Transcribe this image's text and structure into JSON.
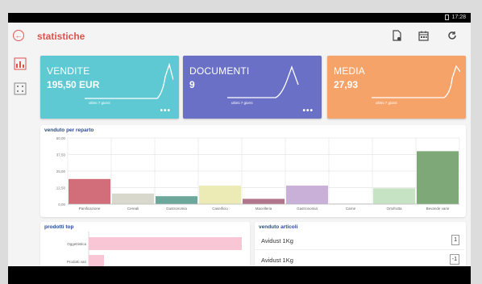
{
  "status": {
    "time": "17:28"
  },
  "app": {
    "title": "statistiche"
  },
  "cards": [
    {
      "label": "VENDITE",
      "value": "195,50 EUR",
      "sub": "ultimi 7 giorni",
      "color": "#5ec9d3"
    },
    {
      "label": "DOCUMENTI",
      "value": "9",
      "sub": "ultimi 7 giorni",
      "color": "#6a70c6"
    },
    {
      "label": "MEDIA",
      "value": "27,93",
      "sub": "ultimi 7 giorni",
      "color": "#f6a36a"
    }
  ],
  "bar_panel": {
    "title": "venduto per reparto"
  },
  "chart_data": {
    "type": "bar",
    "title": "venduto per reparto",
    "categories": [
      "Panificazione",
      "Cereali",
      "Gastronomia",
      "Caseificio",
      "Macelleria",
      "Gastronomia",
      "Carne",
      "Ortofrutta",
      "Bevande varie"
    ],
    "values": [
      19,
      8,
      6,
      14,
      4,
      14,
      0.3,
      12,
      40
    ],
    "colors": [
      "#d16e7a",
      "#d9d8cc",
      "#6ba89b",
      "#ecebb5",
      "#b2768c",
      "#c8b0d8",
      "#7e9a8a",
      "#c6e3c4",
      "#7fa878"
    ],
    "ylim": [
      0,
      50
    ],
    "yticks": [
      "0,00",
      "12,50",
      "25,00",
      "37,50",
      "50,00"
    ],
    "grid": true
  },
  "top_panel": {
    "title": "prodotti top",
    "rows": [
      "Oggettistica",
      "Prodotti vari"
    ],
    "values": [
      100,
      10
    ]
  },
  "art_panel": {
    "title": "venduto articoli",
    "items": [
      {
        "name": "Avidust 1Kg",
        "qty": "1"
      },
      {
        "name": "Avidust 1Kg",
        "qty": "-1"
      }
    ]
  },
  "icons": {
    "back": "arrow-left-icon",
    "doc": "document-icon",
    "calendar": "calendar-icon",
    "refresh": "refresh-icon",
    "side_chart": "bar-chart-icon",
    "side_grid": "grid-icon"
  }
}
